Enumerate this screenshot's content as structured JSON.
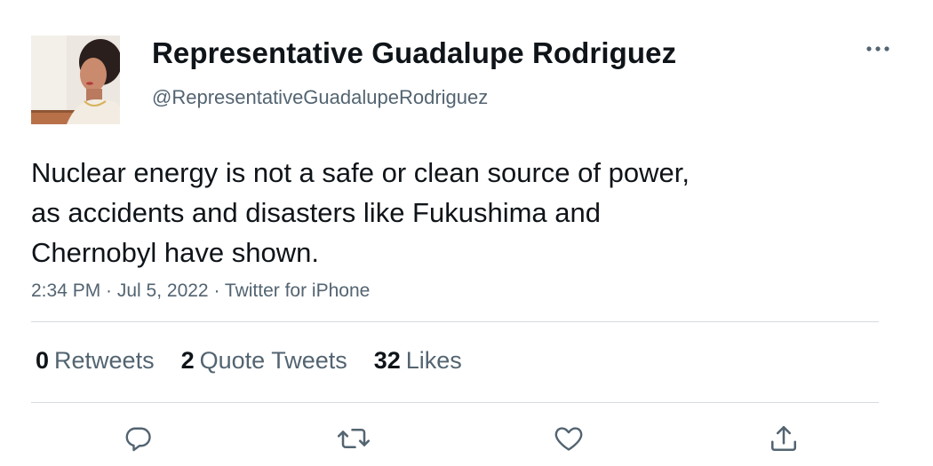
{
  "author": {
    "display_name": "Representative Guadalupe Rodriguez",
    "handle": "@RepresentativeGuadalupeRodriguez"
  },
  "tweet": {
    "text_lines": [
      "Nuclear energy is not a safe or clean source of power,",
      "as accidents and disasters like Fukushima and",
      "Chernobyl have shown."
    ],
    "meta": "2:34 PM · Jul 5, 2022 · Twitter for iPhone"
  },
  "stats": {
    "retweets": {
      "count": "0",
      "label": "Retweets"
    },
    "quote_tweets": {
      "count": "2",
      "label": "Quote Tweets"
    },
    "likes": {
      "count": "32",
      "label": "Likes"
    }
  },
  "icons": {
    "more": "more-horizontal-icon",
    "reply": "reply-icon",
    "retweet": "retweet-icon",
    "like": "heart-icon",
    "share": "share-icon"
  },
  "colors": {
    "text_primary": "#0f1419",
    "text_secondary": "#536471",
    "divider": "#d6dce0"
  }
}
